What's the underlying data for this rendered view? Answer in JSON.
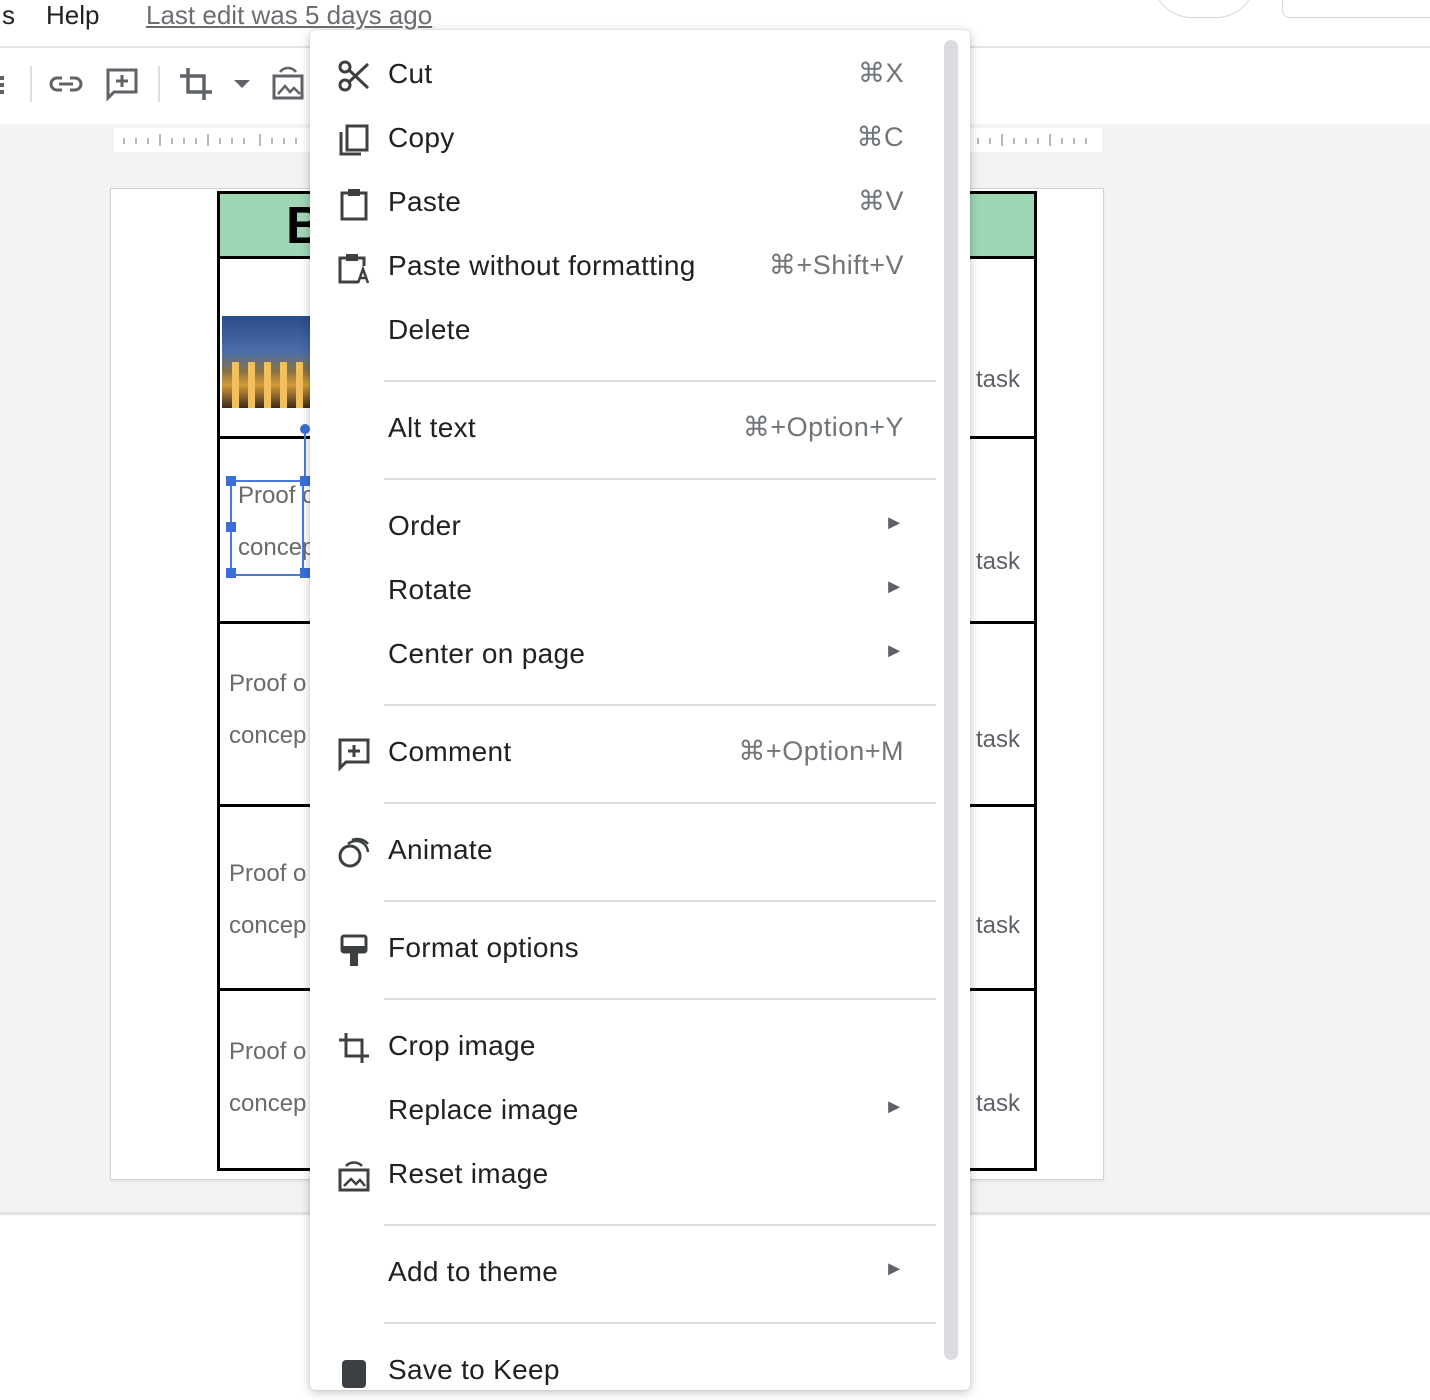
{
  "menubar": {
    "partial_menu": "s",
    "help": "Help",
    "last_edit": "Last edit was 5 days ago"
  },
  "slide": {
    "header_left_char": "B",
    "header_right_char": ")",
    "rows": [
      {
        "left_line1": "",
        "left_line2": "",
        "right_text": "task"
      },
      {
        "left_line1": "Proof c",
        "left_line2": "concep",
        "right_text": "task"
      },
      {
        "left_line1": "Proof o",
        "left_line2": "concep",
        "right_text": "task"
      },
      {
        "left_line1": "Proof o",
        "left_line2": "concep",
        "right_text": "task"
      },
      {
        "left_line1": "Proof o",
        "left_line2": "concep",
        "right_text": "task"
      }
    ]
  },
  "context_menu": {
    "items": [
      {
        "label": "Cut",
        "shortcut": "⌘X",
        "icon": "scissors-icon"
      },
      {
        "label": "Copy",
        "shortcut": "⌘C",
        "icon": "copy-icon"
      },
      {
        "label": "Paste",
        "shortcut": "⌘V",
        "icon": "clipboard-icon"
      },
      {
        "label": "Paste without formatting",
        "shortcut": "⌘+Shift+V",
        "icon": "paste-plain-icon"
      },
      {
        "label": "Delete",
        "shortcut": ""
      },
      {
        "label": "Alt text",
        "shortcut": "⌘+Option+Y"
      },
      {
        "label": "Order",
        "submenu": "►"
      },
      {
        "label": "Rotate",
        "submenu": "►"
      },
      {
        "label": "Center on page",
        "submenu": "►"
      },
      {
        "label": "Comment",
        "shortcut": "⌘+Option+M",
        "icon": "add-comment-icon"
      },
      {
        "label": "Animate",
        "icon": "animate-icon"
      },
      {
        "label": "Format options",
        "icon": "format-paint-icon"
      },
      {
        "label": "Crop image",
        "icon": "crop-icon"
      },
      {
        "label": "Replace image",
        "submenu": "►"
      },
      {
        "label": "Reset image",
        "icon": "reset-image-icon"
      },
      {
        "label": "Add to theme",
        "submenu": "►"
      },
      {
        "label": "Save to Keep",
        "icon": "keep-icon"
      }
    ]
  },
  "colors": {
    "header_fill": "#9fd7b4",
    "selection": "#3b6fd8",
    "menu_text": "#202124",
    "shortcut_text": "#70757a"
  }
}
